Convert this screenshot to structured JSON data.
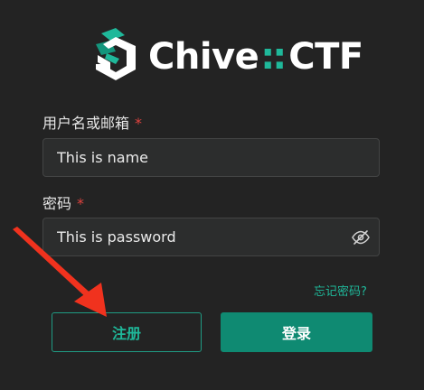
{
  "brand": {
    "name_part_a": "Chive",
    "separator": "::",
    "name_part_b": "CTF",
    "accent_color": "#1fb89a"
  },
  "form": {
    "username": {
      "label": "用户名或邮箱",
      "required_mark": "*",
      "value": "This is name"
    },
    "password": {
      "label": "密码",
      "required_mark": "*",
      "value": "This is password",
      "toggle_icon": "eye-slash-icon"
    },
    "forgot_password_link": "忘记密码?",
    "register_button": "注册",
    "login_button": "登录"
  },
  "annotation": {
    "type": "arrow",
    "color": "#f0321e",
    "points_to": "register-button"
  }
}
